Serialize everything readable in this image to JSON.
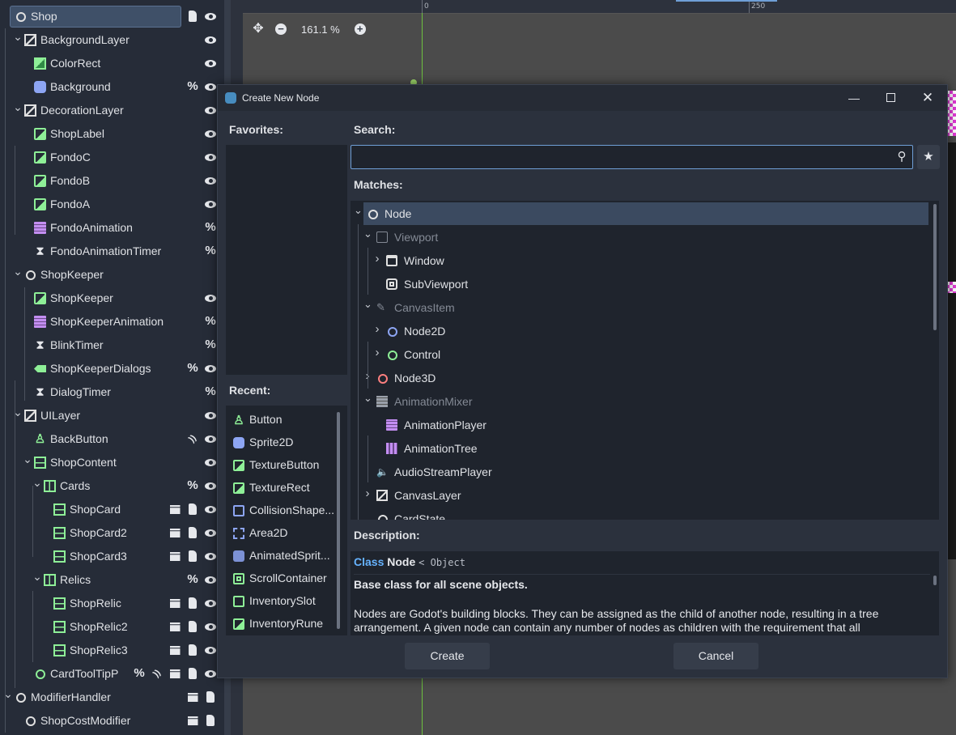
{
  "scene_tree": {
    "rows": [
      {
        "label": "Shop",
        "icon": "node-icon",
        "selected": true,
        "actions": [
          "script-icon",
          "eye-icon"
        ]
      },
      {
        "label": "BackgroundLayer",
        "icon": "canvas-layer-icon",
        "actions": [
          "eye-icon"
        ]
      },
      {
        "label": "ColorRect",
        "icon": "color-rect-icon",
        "actions": [
          "eye-icon"
        ]
      },
      {
        "label": "Background",
        "icon": "sprite-icon",
        "actions": [
          "percent-icon",
          "eye-icon"
        ]
      },
      {
        "label": "DecorationLayer",
        "icon": "canvas-layer-icon",
        "actions": [
          "eye-icon"
        ]
      },
      {
        "label": "ShopLabel",
        "icon": "texture-rect-icon",
        "actions": [
          "eye-icon"
        ]
      },
      {
        "label": "FondoC",
        "icon": "texture-rect-icon",
        "actions": [
          "eye-icon"
        ]
      },
      {
        "label": "FondoB",
        "icon": "texture-rect-icon",
        "actions": [
          "eye-icon"
        ]
      },
      {
        "label": "FondoA",
        "icon": "texture-rect-icon",
        "actions": [
          "eye-icon"
        ]
      },
      {
        "label": "FondoAnimation",
        "icon": "animation-player-icon",
        "actions": [
          "percent-icon"
        ]
      },
      {
        "label": "FondoAnimationTimer",
        "icon": "timer-icon",
        "actions": [
          "percent-icon"
        ]
      },
      {
        "label": "ShopKeeper",
        "icon": "node-icon",
        "actions": []
      },
      {
        "label": "ShopKeeper",
        "icon": "texture-rect-icon",
        "actions": [
          "eye-icon"
        ]
      },
      {
        "label": "ShopKeeperAnimation",
        "icon": "animation-player-icon",
        "actions": [
          "percent-icon"
        ]
      },
      {
        "label": "BlinkTimer",
        "icon": "timer-icon",
        "actions": [
          "percent-icon"
        ]
      },
      {
        "label": "ShopKeeperDialogs",
        "icon": "label-icon",
        "actions": [
          "percent-icon",
          "eye-icon"
        ]
      },
      {
        "label": "DialogTimer",
        "icon": "timer-icon",
        "actions": [
          "percent-icon"
        ]
      },
      {
        "label": "UILayer",
        "icon": "canvas-layer-icon",
        "actions": [
          "eye-icon"
        ]
      },
      {
        "label": "BackButton",
        "icon": "button-icon",
        "actions": [
          "signal-icon",
          "eye-icon"
        ]
      },
      {
        "label": "ShopContent",
        "icon": "vbox-icon",
        "actions": [
          "eye-icon"
        ]
      },
      {
        "label": "Cards",
        "icon": "hbox-icon",
        "actions": [
          "percent-icon",
          "eye-icon"
        ]
      },
      {
        "label": "ShopCard",
        "icon": "vbox-icon",
        "actions": [
          "clapper-icon",
          "script-icon",
          "eye-icon"
        ]
      },
      {
        "label": "ShopCard2",
        "icon": "vbox-icon",
        "actions": [
          "clapper-icon",
          "script-icon",
          "eye-icon"
        ]
      },
      {
        "label": "ShopCard3",
        "icon": "vbox-icon",
        "actions": [
          "clapper-icon",
          "script-icon",
          "eye-icon"
        ]
      },
      {
        "label": "Relics",
        "icon": "hbox-icon",
        "actions": [
          "percent-icon",
          "eye-icon"
        ]
      },
      {
        "label": "ShopRelic",
        "icon": "vbox-icon",
        "actions": [
          "clapper-icon",
          "script-icon",
          "eye-icon"
        ]
      },
      {
        "label": "ShopRelic2",
        "icon": "vbox-icon",
        "actions": [
          "clapper-icon",
          "script-icon",
          "eye-icon"
        ]
      },
      {
        "label": "ShopRelic3",
        "icon": "vbox-icon",
        "actions": [
          "clapper-icon",
          "script-icon",
          "eye-icon"
        ]
      },
      {
        "label": "CardToolTipP",
        "icon": "control-icon",
        "actions": [
          "percent-icon",
          "signal-icon",
          "clapper-icon",
          "script-icon",
          "eye-icon"
        ]
      },
      {
        "label": "ModifierHandler",
        "icon": "node-icon",
        "actions": [
          "clapper-icon",
          "script-icon"
        ]
      },
      {
        "label": "ShopCostModifier",
        "icon": "node-icon",
        "actions": [
          "clapper-icon",
          "script-icon"
        ]
      }
    ]
  },
  "viewport": {
    "zoom_label": "161.1 %",
    "ruler_labels": [
      "0",
      "250"
    ]
  },
  "dialog": {
    "title": "Create New Node",
    "favorites_label": "Favorites:",
    "recent_label": "Recent:",
    "search_label": "Search:",
    "search_value": "",
    "search_placeholder": "",
    "matches_label": "Matches:",
    "description_label": "Description:",
    "create_label": "Create",
    "cancel_label": "Cancel",
    "recent": [
      {
        "label": "Button",
        "icon": "button-icon"
      },
      {
        "label": "Sprite2D",
        "icon": "sprite-icon"
      },
      {
        "label": "TextureButton",
        "icon": "texture-button-icon"
      },
      {
        "label": "TextureRect",
        "icon": "texture-rect-icon"
      },
      {
        "label": "CollisionShape...",
        "icon": "collision-shape-icon"
      },
      {
        "label": "Area2D",
        "icon": "area2d-icon"
      },
      {
        "label": "AnimatedSprit...",
        "icon": "animated-sprite-icon"
      },
      {
        "label": "ScrollContainer",
        "icon": "scroll-container-icon"
      },
      {
        "label": "InventorySlot",
        "icon": "panel-icon"
      },
      {
        "label": "InventoryRune",
        "icon": "texture-rect-icon"
      }
    ],
    "matches": [
      {
        "label": "Node",
        "depth": 0,
        "chev": "down",
        "icon": "node-icon",
        "selected": true,
        "dim": false
      },
      {
        "label": "Viewport",
        "depth": 1,
        "chev": "down",
        "icon": "viewport-icon",
        "dim": true
      },
      {
        "label": "Window",
        "depth": 2,
        "chev": "right",
        "icon": "window-icon",
        "dim": false
      },
      {
        "label": "SubViewport",
        "depth": 2,
        "chev": "",
        "icon": "subviewport-icon",
        "dim": false
      },
      {
        "label": "CanvasItem",
        "depth": 1,
        "chev": "down",
        "icon": "canvas-item-icon",
        "dim": true
      },
      {
        "label": "Node2D",
        "depth": 2,
        "chev": "right",
        "icon": "node2d-icon",
        "dim": false
      },
      {
        "label": "Control",
        "depth": 2,
        "chev": "right",
        "icon": "control-icon",
        "dim": false
      },
      {
        "label": "Node3D",
        "depth": 1,
        "chev": "right",
        "icon": "node3d-icon",
        "dim": false
      },
      {
        "label": "AnimationMixer",
        "depth": 1,
        "chev": "down",
        "icon": "animation-mixer-icon",
        "dim": true
      },
      {
        "label": "AnimationPlayer",
        "depth": 2,
        "chev": "",
        "icon": "animation-player-icon",
        "dim": false
      },
      {
        "label": "AnimationTree",
        "depth": 2,
        "chev": "",
        "icon": "animation-tree-icon",
        "dim": false
      },
      {
        "label": "AudioStreamPlayer",
        "depth": 1,
        "chev": "",
        "icon": "audio-icon",
        "dim": false
      },
      {
        "label": "CanvasLayer",
        "depth": 1,
        "chev": "right",
        "icon": "canvas-layer-icon",
        "dim": false
      },
      {
        "label": "CardState",
        "depth": 1,
        "chev": "",
        "icon": "node-icon",
        "dim": false
      }
    ],
    "description": {
      "keyword": "Class",
      "name": "Node",
      "inherits": "< Object",
      "brief": "Base class for all scene objects.",
      "body": "Nodes are Godot's building blocks. They can be assigned as the child of another node, resulting in a tree arrangement. A given node can contain any number of nodes as children with the requirement that all"
    }
  }
}
